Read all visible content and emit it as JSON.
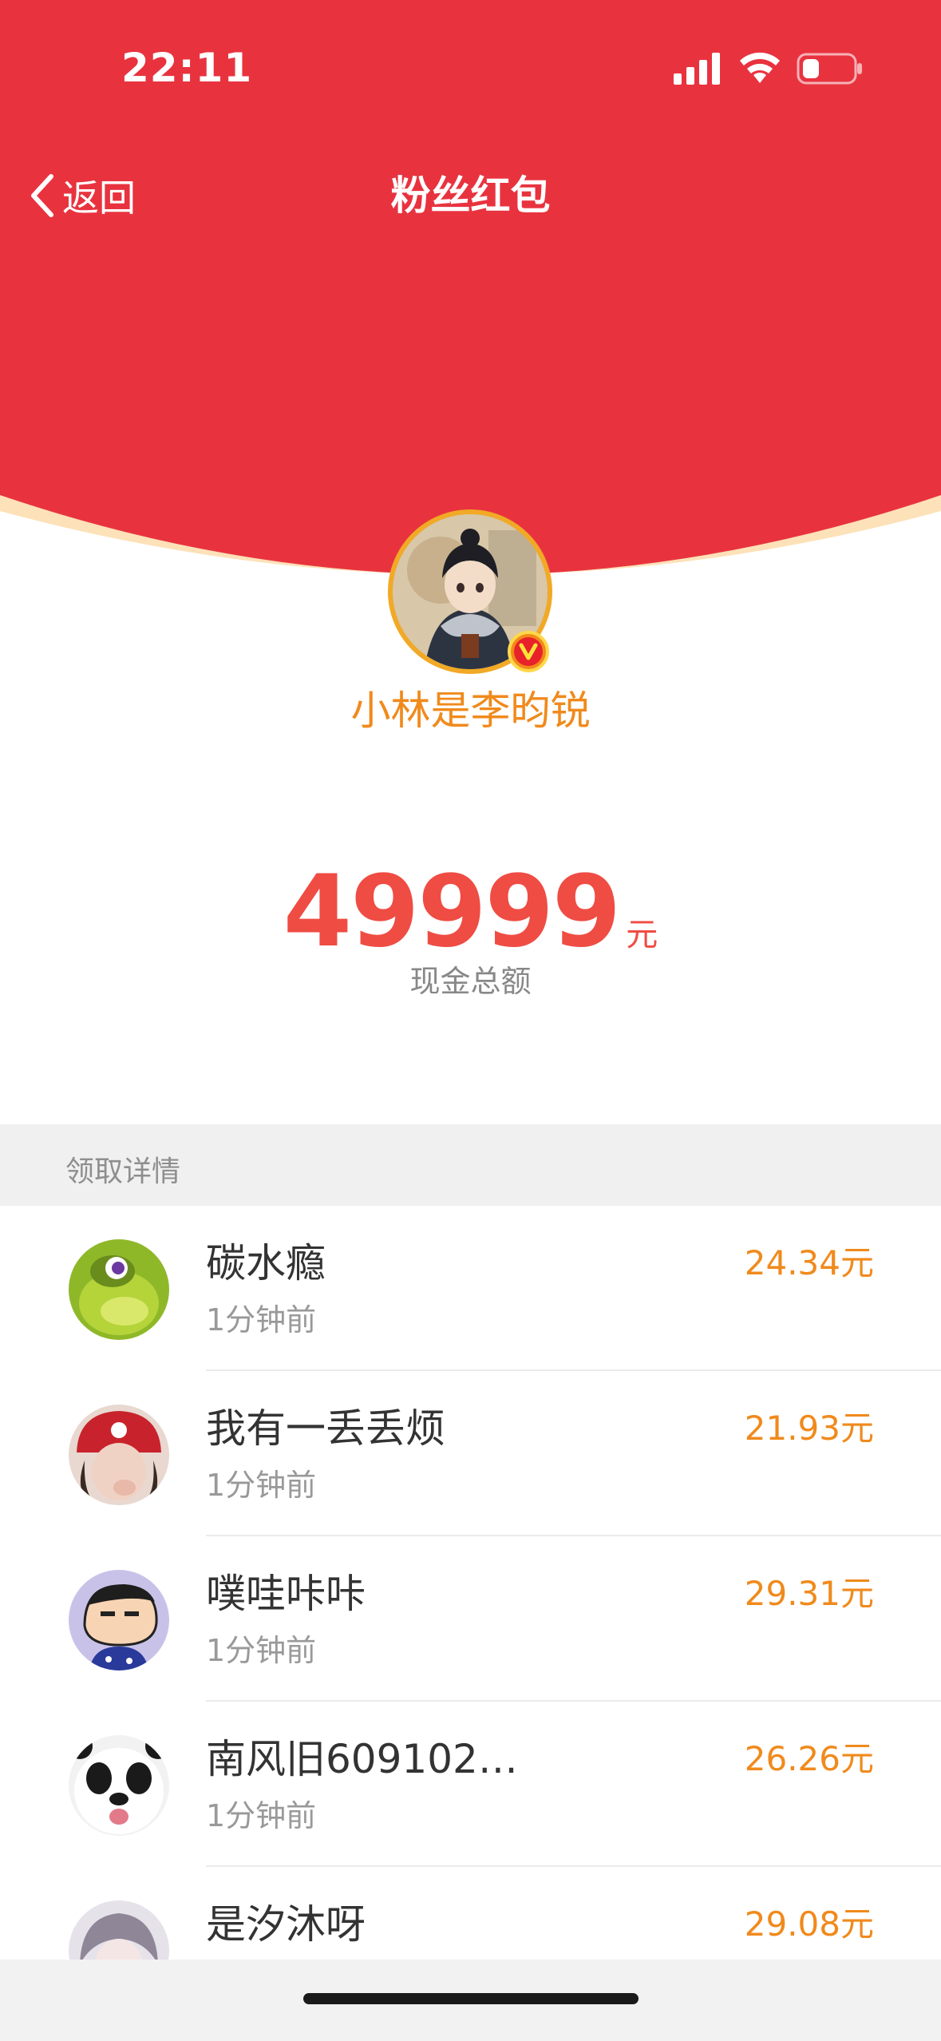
{
  "status_bar": {
    "time": "22:11"
  },
  "nav": {
    "back_label": "返回",
    "title": "粉丝红包"
  },
  "sender": {
    "name": "小林是李昀锐",
    "badge": "V"
  },
  "amount": {
    "value": "49999",
    "unit": "元",
    "label": "现金总额"
  },
  "section": {
    "title": "领取详情"
  },
  "records": [
    {
      "name": "碳水瘾",
      "time": "1分钟前",
      "amount": "24.34元"
    },
    {
      "name": "我有一丢丢烦",
      "time": "1分钟前",
      "amount": "21.93元"
    },
    {
      "name": "噗哇咔咔",
      "time": "1分钟前",
      "amount": "29.31元"
    },
    {
      "name": "南风旧609102…",
      "time": "1分钟前",
      "amount": "26.26元"
    },
    {
      "name": "是汐沐呀",
      "time": "",
      "amount": "29.08元"
    }
  ],
  "colors": {
    "header_red": "#e8333f",
    "accent_orange": "#f08a1c",
    "amount_red": "#ef4c43"
  }
}
